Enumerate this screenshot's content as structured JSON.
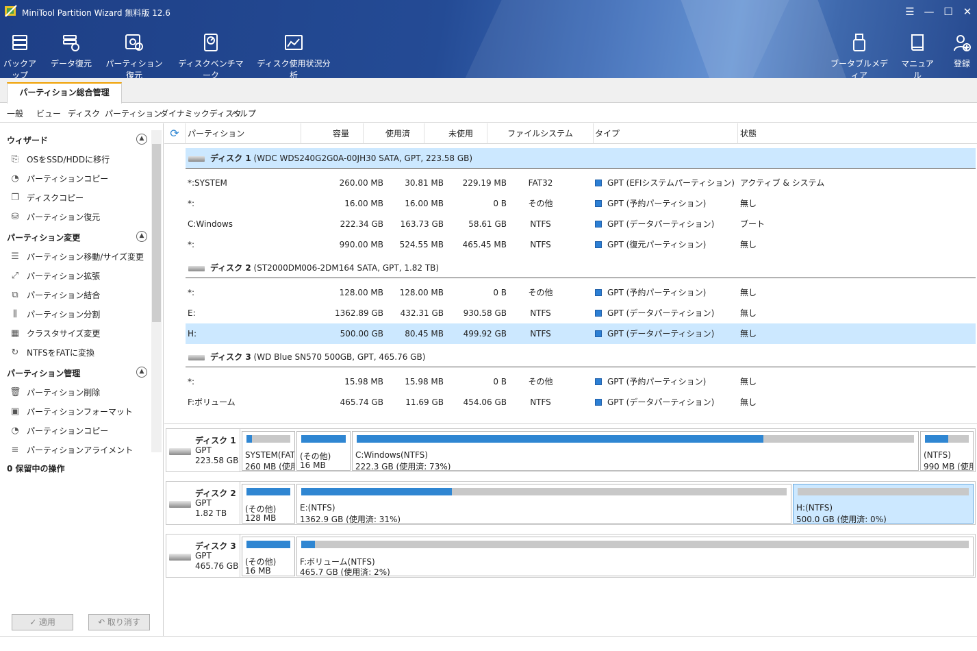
{
  "app": {
    "title": "MiniTool Partition Wizard 無料版 12.6"
  },
  "window_controls": {
    "menu": "☰",
    "minimize": "—",
    "maximize": "☐",
    "close": "✕"
  },
  "toolbar": {
    "backup": "バックアップ",
    "data_recovery": "データ復元",
    "partition_recovery": "パーティション復元",
    "disk_benchmark": "ディスクベンチマーク",
    "space_analyzer": "ディスク使用状況分析",
    "bootable_media": "ブータブルメディア",
    "manual": "マニュアル",
    "register": "登録"
  },
  "tabs": {
    "main": "パーティション総合管理"
  },
  "menu": {
    "general": "一般",
    "view": "ビュー",
    "disk": "ディスク",
    "partition": "パーティション",
    "dynamic": "ダイナミックディスク",
    "help": "ヘルプ"
  },
  "left": {
    "wizard": {
      "title": "ウィザード",
      "items": [
        "OSをSSD/HDDに移行",
        "パーティションコピー",
        "ディスクコピー",
        "パーティション復元"
      ]
    },
    "change": {
      "title": "パーティション変更",
      "items": [
        "パーティション移動/サイズ変更",
        "パーティション拡張",
        "パーティション結合",
        "パーティション分割",
        "クラスタサイズ変更",
        "NTFSをFATに変換"
      ]
    },
    "manage": {
      "title": "パーティション管理",
      "items": [
        "パーティション削除",
        "パーティションフォーマット",
        "パーティションコピー",
        "パーティションアライメント"
      ]
    },
    "pending": "0 保留中の操作",
    "apply": "✓ 適用",
    "undo": "↶ 取り消す"
  },
  "table": {
    "headers": {
      "partition": "パーティション",
      "capacity": "容量",
      "used": "使用済",
      "unused": "未使用",
      "fs": "ファイルシステム",
      "type": "タイプ",
      "status": "状態"
    },
    "disks": [
      {
        "name": "ディスク 1",
        "info": "(WDC WDS240G2G0A-00JH30 SATA, GPT, 223.58 GB)"
      },
      {
        "name": "ディスク 2",
        "info": "(ST2000DM006-2DM164 SATA, GPT, 1.82 TB)"
      },
      {
        "name": "ディスク 3",
        "info": "(WD Blue SN570 500GB, GPT, 465.76 GB)"
      }
    ],
    "rows": [
      [
        "*:SYSTEM",
        "260.00 MB",
        "30.81 MB",
        "229.19 MB",
        "FAT32",
        "GPT (EFIシステムパーティション)",
        "アクティブ & システム"
      ],
      [
        "*:",
        "16.00 MB",
        "16.00 MB",
        "0 B",
        "その他",
        "GPT (予約パーティション)",
        "無し"
      ],
      [
        "C:Windows",
        "222.34 GB",
        "163.73 GB",
        "58.61 GB",
        "NTFS",
        "GPT (データパーティション)",
        "ブート"
      ],
      [
        "*:",
        "990.00 MB",
        "524.55 MB",
        "465.45 MB",
        "NTFS",
        "GPT (復元パーティション)",
        "無し"
      ],
      [
        "*:",
        "128.00 MB",
        "128.00 MB",
        "0 B",
        "その他",
        "GPT (予約パーティション)",
        "無し"
      ],
      [
        "E:",
        "1362.89 GB",
        "432.31 GB",
        "930.58 GB",
        "NTFS",
        "GPT (データパーティション)",
        "無し"
      ],
      [
        "H:",
        "500.00 GB",
        "80.45 MB",
        "499.92 GB",
        "NTFS",
        "GPT (データパーティション)",
        "無し"
      ],
      [
        "*:",
        "15.98 MB",
        "15.98 MB",
        "0 B",
        "その他",
        "GPT (予約パーティション)",
        "無し"
      ],
      [
        "F:ボリューム",
        "465.74 GB",
        "11.69 GB",
        "454.06 GB",
        "NTFS",
        "GPT (データパーティション)",
        "無し"
      ]
    ]
  },
  "map": {
    "disks": [
      {
        "name": "ディスク 1",
        "scheme": "GPT",
        "size": "223.58 GB",
        "parts": [
          {
            "l1": "SYSTEM(FAT3",
            "l2": "260 MB (使用",
            "usage": 0.12
          },
          {
            "l1": "(その他)",
            "l2": "16 MB",
            "usage": 1.0
          },
          {
            "l1": "C:Windows(NTFS)",
            "l2": "222.3 GB (使用済: 73%)",
            "usage": 0.73
          },
          {
            "l1": "(NTFS)",
            "l2": "990 MB (使用",
            "usage": 0.53
          }
        ]
      },
      {
        "name": "ディスク 2",
        "scheme": "GPT",
        "size": "1.82 TB",
        "parts": [
          {
            "l1": "(その他)",
            "l2": "128 MB",
            "usage": 1.0
          },
          {
            "l1": "E:(NTFS)",
            "l2": "1362.9 GB (使用済: 31%)",
            "usage": 0.31
          },
          {
            "l1": "H:(NTFS)",
            "l2": "500.0 GB (使用済: 0%)",
            "usage": 0.0
          }
        ]
      },
      {
        "name": "ディスク 3",
        "scheme": "GPT",
        "size": "465.76 GB",
        "parts": [
          {
            "l1": "(その他)",
            "l2": "16 MB",
            "usage": 1.0
          },
          {
            "l1": "F:ボリューム(NTFS)",
            "l2": "465.7 GB (使用済: 2%)",
            "usage": 0.02
          }
        ]
      }
    ]
  },
  "colors": {
    "accent": "#2f86d2",
    "selected": "#cce8ff",
    "header": "#244b95"
  }
}
